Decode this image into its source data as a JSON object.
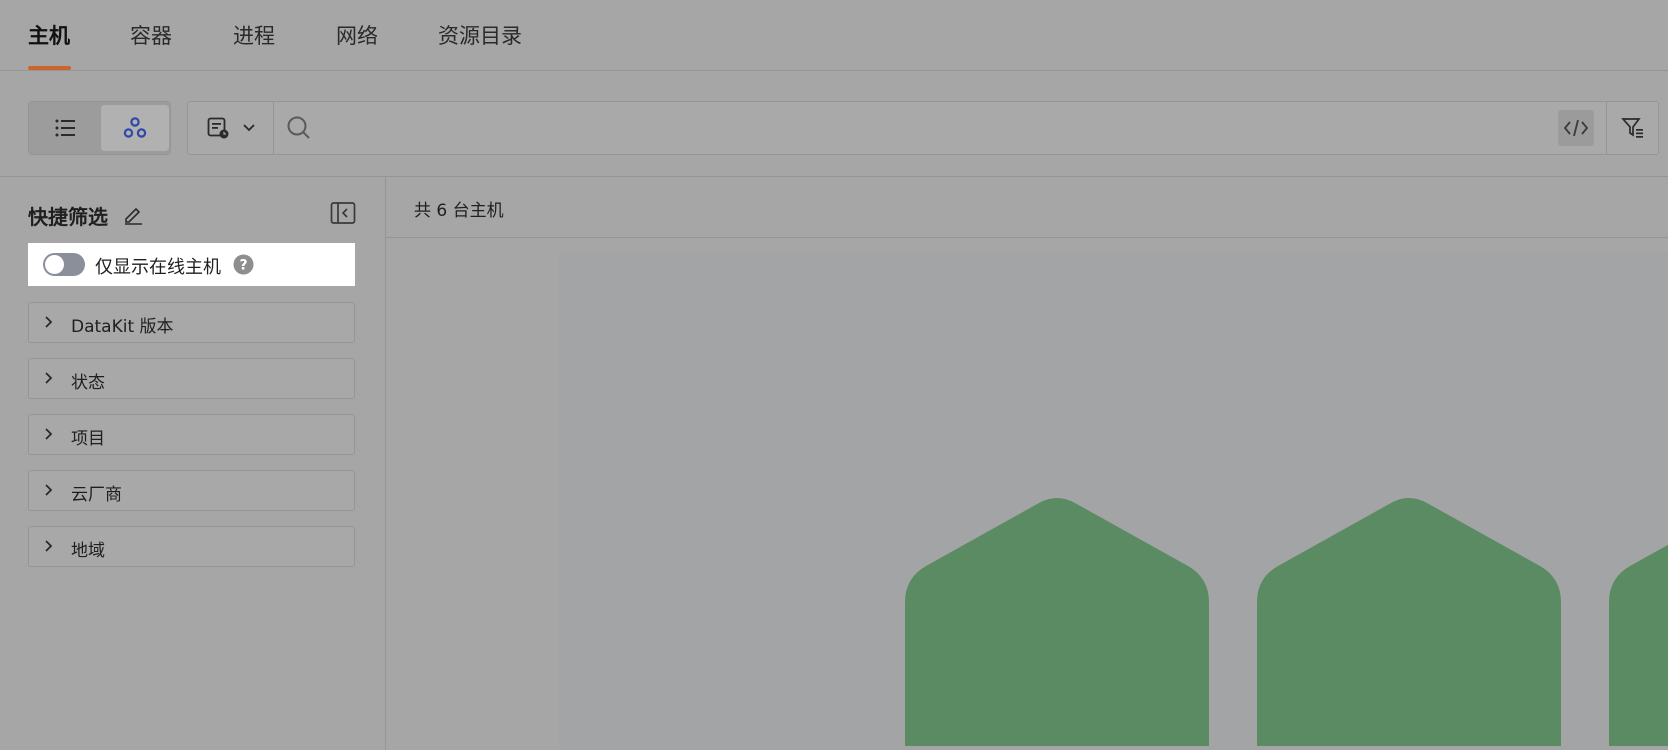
{
  "tabs": [
    {
      "label": "主机",
      "active": true
    },
    {
      "label": "容器",
      "active": false
    },
    {
      "label": "进程",
      "active": false
    },
    {
      "label": "网络",
      "active": false
    },
    {
      "label": "资源目录",
      "active": false
    }
  ],
  "colors": {
    "accent_underline": "#c8662e",
    "hex_fill": "#5b8b62",
    "hex_view_icon": "#2e4aa8"
  },
  "toolbar": {
    "view_modes": [
      "list-icon",
      "hexagon-cluster-icon"
    ],
    "active_view": "hexagon-cluster-icon",
    "query_icon": "query-doc-icon",
    "search_placeholder": "",
    "search_value": "",
    "code_icon": "code-icon",
    "filter_icon": "filter-icon"
  },
  "sidebar": {
    "title": "快捷筛选",
    "online_toggle": {
      "label": "仅显示在线主机",
      "enabled": false
    },
    "groups": [
      {
        "label": "DataKit 版本"
      },
      {
        "label": "状态"
      },
      {
        "label": "项目"
      },
      {
        "label": "云厂商"
      },
      {
        "label": "地域"
      }
    ]
  },
  "main": {
    "host_count": "共 6 台主机"
  }
}
